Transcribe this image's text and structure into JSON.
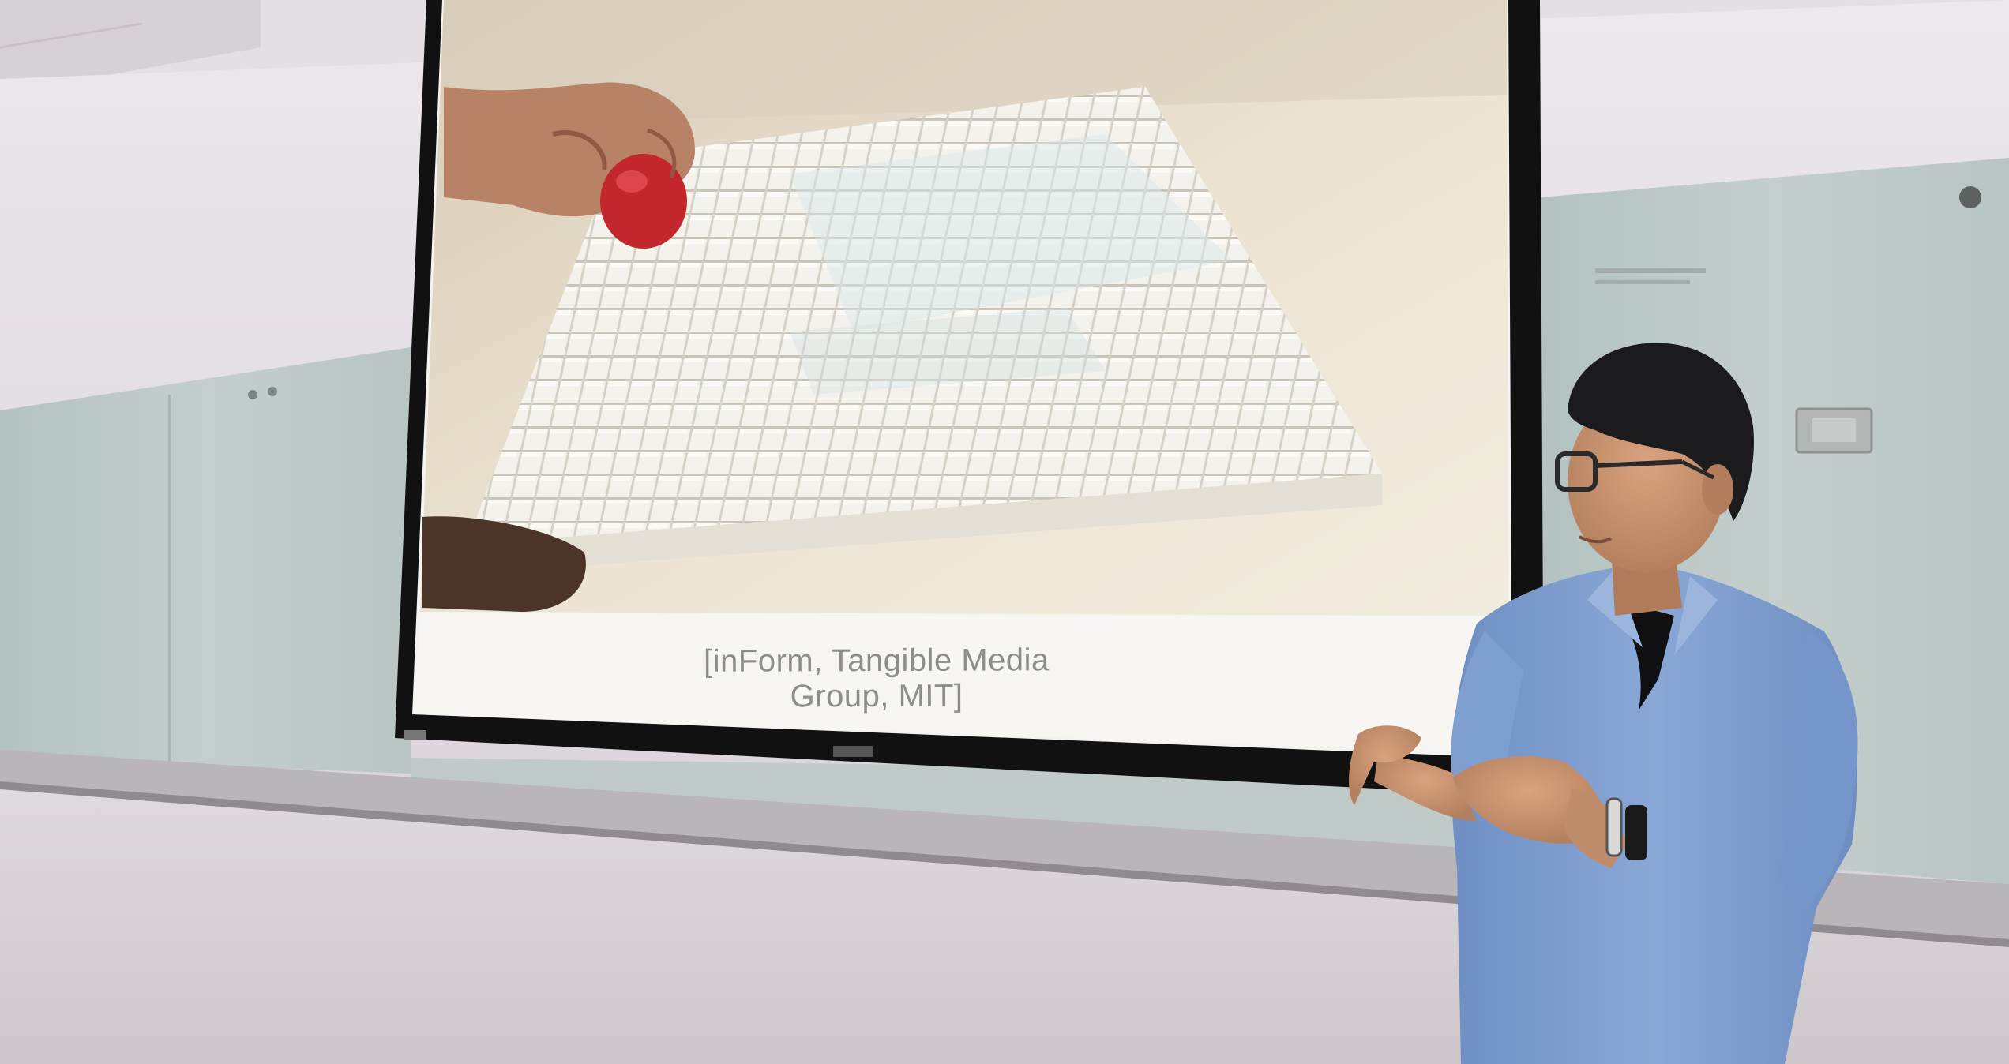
{
  "slide": {
    "caption": "[inForm, Tangible Media Group, MIT]"
  },
  "colors": {
    "ceiling": "#e3dfe2",
    "wall": "#e6e1e6",
    "whiteboard": "#bfcbc9",
    "screen_frame": "#111111",
    "slide_photo_bg": "#e8dfcf",
    "pin_display": "#f3f1ea",
    "shirt": "#7e9fd0",
    "hair": "#1b1b1d",
    "floor": "#d7d2d6"
  }
}
